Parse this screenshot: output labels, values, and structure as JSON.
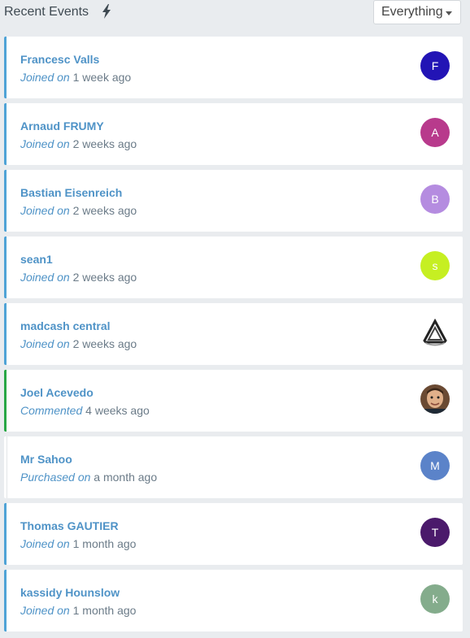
{
  "header": {
    "title": "Recent Events",
    "filter": "Everything"
  },
  "events": [
    {
      "name": "Francesc Valls",
      "verb": "Joined on",
      "time": "1 week ago",
      "initial": "F",
      "color": "#2214b5"
    },
    {
      "name": "Arnaud FRUMY",
      "verb": "Joined on",
      "time": "2 weeks ago",
      "initial": "A",
      "color": "#b83a8c"
    },
    {
      "name": "Bastian Eisenreich",
      "verb": "Joined on",
      "time": "2 weeks ago",
      "initial": "B",
      "color": "#b58ce0"
    },
    {
      "name": "sean1",
      "verb": "Joined on",
      "time": "2 weeks ago",
      "initial": "s",
      "color": "#c6ef22"
    },
    {
      "name": "madcash central",
      "verb": "Joined on",
      "time": "2 weeks ago",
      "initial": "",
      "color": "#ffffff"
    },
    {
      "name": "Joel Acevedo",
      "verb": "Commented",
      "time": "4 weeks ago",
      "initial": "",
      "color": "#ffffff"
    },
    {
      "name": "Mr Sahoo",
      "verb": "Purchased on",
      "time": "a month ago",
      "initial": "M",
      "color": "#5b83c9"
    },
    {
      "name": "Thomas GAUTIER",
      "verb": "Joined on",
      "time": "1 month ago",
      "initial": "T",
      "color": "#4b1a6b"
    },
    {
      "name": "kassidy Hounslow",
      "verb": "Joined on",
      "time": "1 month ago",
      "initial": "k",
      "color": "#84ac8c"
    }
  ]
}
